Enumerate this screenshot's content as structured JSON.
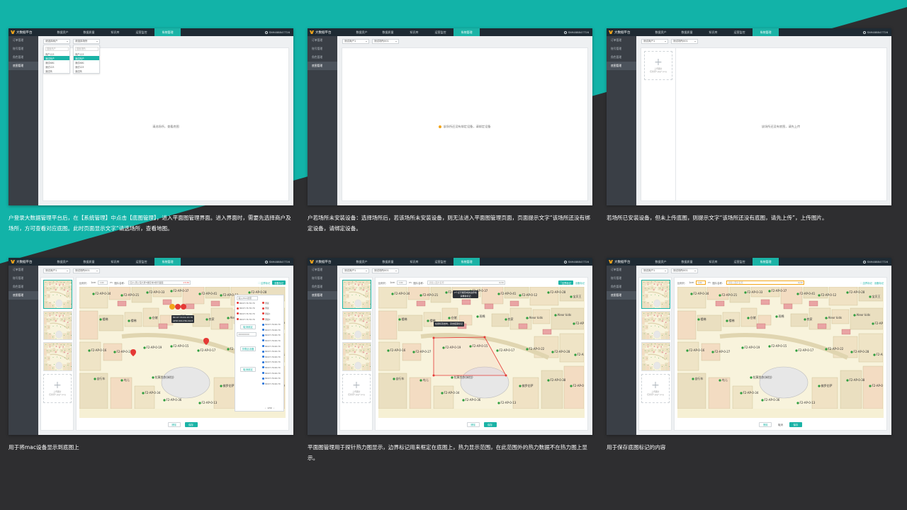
{
  "colors": {
    "accent": "#1ab3a6",
    "topbar": "#1e2a33",
    "sidebar": "#3a3f46",
    "background": "#2e2e30",
    "warning": "#f2a51a",
    "device_marker": "#e53935",
    "heat_boundary": "#e53935"
  },
  "app": {
    "title": "大数据平台",
    "nav": [
      "数据资产",
      "数据质量",
      "知识库",
      "运营监控",
      "系统管理"
    ],
    "user": "SN9488847726",
    "sidebar": [
      "订单管理",
      "账号管理",
      "角色管理",
      "底图管理"
    ]
  },
  "panel1": {
    "select_merchant": "请选择商户",
    "select_venue": "请选择场所",
    "merchant_search": "搜索商户",
    "venue_search": "搜索场所",
    "merchant_options": [
      "商户123",
      "测试商户",
      "测试ABC",
      "测试123",
      "测试商"
    ],
    "venue_options": [
      "商户123",
      "测试商户",
      "测试ABC",
      "测试123",
      "测试商"
    ],
    "message": "请选场所，查看底图"
  },
  "panel2": {
    "select_merchant": "测试商户1",
    "select_venue": "测试场所001",
    "message": "该场所还没有绑定设备，请绑定设备"
  },
  "panel3": {
    "select_merchant": "测试商户1",
    "select_venue": "测试场所001",
    "upload_label": "上传图片",
    "upload_hint": "仅支持*.jpg/*.png",
    "message": "该场所还没有底图，请先上传"
  },
  "panel4": {
    "select_merchant": "测试商户1",
    "select_venue": "测试场所001",
    "scale_label": "比例尺：",
    "scale_unit": "1cm",
    "scale_value": "100",
    "unit": "m",
    "name_label": "图片名称：",
    "name_value": "四川-唐公馆大厦5楼区域2楼平面图",
    "name_count": "17/30",
    "link_boundary": "边界标记",
    "btn_add_device": "设备标记",
    "device_search": "输入MAC搜索",
    "devices_a": [
      "80:07:74:70:70",
      "80:07:74:70:70",
      "80:07:74:70:70",
      "80:07:74:70:70"
    ],
    "devices_b": [
      "测试",
      "测试",
      "测试1",
      "测试2",
      "80:07:74:00:70",
      "80:07:74:00:70",
      "80:07:74:00:70",
      "80:07:74:00:70",
      "80:07:74:00:70",
      "80:07:74:00:70",
      "80:07:74:00:70",
      "80:07:74:00:70",
      "80:07:74:00:70",
      "80:07:74:00:70",
      "80:07:74:00:70",
      "80:07:74:00:70"
    ],
    "btn_unbind": "取消绑定",
    "input_mac": "00000000",
    "btn_bind": "关联此设备",
    "btn_bind2": "取消绑定",
    "pager": "1/50",
    "tooltip": "80:07:74:01:23:70\nAPID:001236-0123",
    "upload_label": "上传图片",
    "upload_hint": "仅支持*.jpg/*.png",
    "btn_cancel": "清除",
    "btn_save": "保存"
  },
  "panel5": {
    "select_merchant": "测试商户1",
    "select_venue": "测试场所001",
    "scale_label": "比例尺：",
    "scale_unit": "1cm",
    "scale_value": "100",
    "unit": "m",
    "name_label": "图片名称：",
    "name_placeholder": "请输入图片名称",
    "name_count": "0/30",
    "link_boundary": "边界标记",
    "btn_add_device": "设备标记",
    "tip_top": "2个点不能形成的边界线\n请重新标记",
    "tip_mid": "在鼠标双击时，双击结束标记",
    "upload_label": "上传图片",
    "upload_hint": "仅支持*.jpg/*.png",
    "btn_cancel": "清除",
    "btn_save": "保存"
  },
  "panel6": {
    "select_merchant": "测试商户1",
    "select_venue": "测试场所001",
    "scale_label": "比例尺：",
    "scale_unit": "1cm",
    "scale_value": "100",
    "unit": "m",
    "name_label": "图片名称：",
    "name_placeholder": "请输入图片名称",
    "name_count": "0/30",
    "link_boundary": "边界标记",
    "btn_add_device": "设备标记",
    "upload_label": "上传图片",
    "upload_hint": "仅支持*.jpg/*.png",
    "btn_cancel": "清除",
    "btn_mid": "取消",
    "btn_save": "保存"
  },
  "captions": [
    "户登录大数据管理平台后，在【系统管理】中点击【底图管理】，进入平面图管理界面。进入界面时，需要先选择商户及场所，方可查看对应底图。此时页面显示文字“请选场所，查看地图。",
    "户若场所未安装设备：选择场所后，若该场所未安装设备，则无法进入平面图管理页面，页面提示文字“该场所还没有绑定设备，请绑定设备。",
    "若场所已安装设备，但未上传底图，则提示文字“该场所还没有底图，请先上传”，上传图片。",
    "用于将mac设备显示到底图上",
    "平面图管理用于探针热力图显示，边界标记用来框定在底图上，热力显示范围，在此范围外的热力数据不在热力图上显示。",
    "用于保存底图标记的内容"
  ],
  "map_labels": [
    "F2-AP-0-34",
    "F2-AP-0-21",
    "F2-AP-0-33",
    "F2-AP-0-37",
    "F2-AP-0-41",
    "F2-AP-0-12",
    "F2-AP-0-28",
    "宝贝王",
    "楼梯",
    "楼梯",
    "仓储",
    "雨棉",
    "农家",
    "Alexr kids",
    "Alexr kids",
    "F2-AP-0-18",
    "F2-AP-0-16",
    "F2-AP-0-27",
    "F2-AP-0-19",
    "F2-AP-0-15",
    "F2-AP-0-17",
    "F2-AP-0-22",
    "F2-AP-0-28",
    "F2-AP-0-26",
    "自行车",
    "鸟儿",
    "拉莫优衣(米拉)",
    "佛罗伦萨",
    "F2-AP-0-38",
    "F2-AP-0-32",
    "F2-AP-0-36",
    "F2-AP-0-13"
  ]
}
